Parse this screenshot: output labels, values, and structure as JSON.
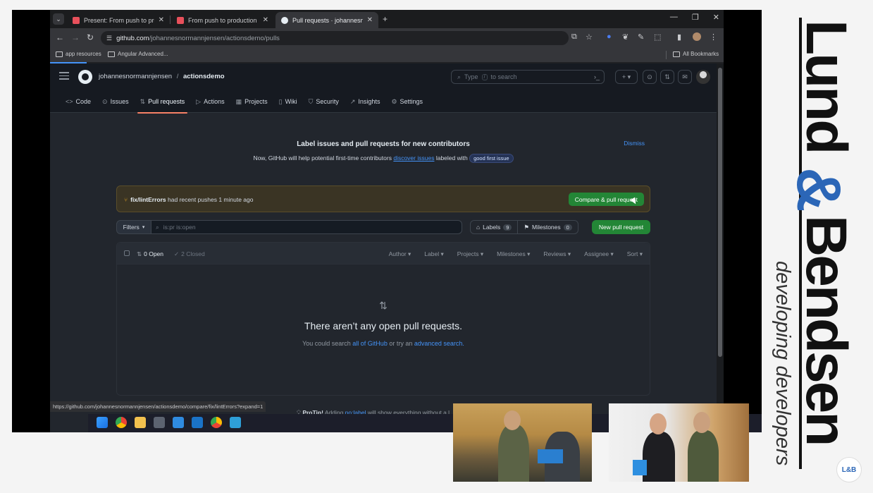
{
  "browser": {
    "tabs": [
      {
        "title": "Present: From push to producti",
        "favicon_color": "#e8505b",
        "active": false
      },
      {
        "title": "From push to production",
        "favicon_color": "#e8505b",
        "active": false
      },
      {
        "title": "Pull requests · johannesnormar",
        "favicon_color": "#e6edf3",
        "active": true
      }
    ],
    "new_tab": "+",
    "url_host": "github.com",
    "url_path": "/johannesnormannjensen/actionsdemo/pulls",
    "bookmarks": [
      "app resources",
      "Angular Advanced..."
    ],
    "all_bookmarks": "All Bookmarks",
    "status_url": "https://github.com/johannesnormannjensen/actionsdemo/compare/fix/lintErrors?expand=1"
  },
  "github": {
    "owner": "johannesnormannjensen",
    "separator": "/",
    "repo": "actionsdemo",
    "search_placeholder_pre": "Type",
    "search_slash": "/",
    "search_placeholder_post": "to search",
    "repo_nav": [
      {
        "label": "Code",
        "icon": "<>"
      },
      {
        "label": "Issues",
        "icon": "⊙"
      },
      {
        "label": "Pull requests",
        "icon": "⇅"
      },
      {
        "label": "Actions",
        "icon": "▷"
      },
      {
        "label": "Projects",
        "icon": "▦"
      },
      {
        "label": "Wiki",
        "icon": "▯"
      },
      {
        "label": "Security",
        "icon": "⛉"
      },
      {
        "label": "Insights",
        "icon": "↗"
      },
      {
        "label": "Settings",
        "icon": "⚙"
      }
    ],
    "banner": {
      "title": "Label issues and pull requests for new contributors",
      "text_pre": "Now, GitHub will help potential first-time contributors",
      "link": "discover issues",
      "text_mid": "labeled with",
      "label": "good first issue",
      "dismiss": "Dismiss"
    },
    "push": {
      "branch": "fix/lintErrors",
      "text": "had recent pushes 1 minute ago",
      "button": "Compare & pull request"
    },
    "filters": {
      "button": "Filters",
      "query": "is:pr is:open",
      "labels": "Labels",
      "labels_count": "9",
      "milestones": "Milestones",
      "milestones_count": "0",
      "new_pr": "New pull request"
    },
    "list": {
      "open": "0 Open",
      "closed": "2 Closed",
      "sorts": [
        "Author",
        "Label",
        "Projects",
        "Milestones",
        "Reviews",
        "Assignee",
        "Sort"
      ],
      "empty_title": "There aren’t any open pull requests.",
      "empty_pre": "You could search",
      "empty_link1": "all of GitHub",
      "empty_mid": "or try an",
      "empty_link2": "advanced search."
    },
    "protip": {
      "label": "ProTip!",
      "pre": "Adding",
      "link": "no:label",
      "post": "will show everything without a l"
    }
  },
  "branding": {
    "word1": "Lund",
    "amp": "&",
    "word2": "Bendsen",
    "tagline": "developing developers",
    "badge": "L&B",
    "blue": "#2b66b7"
  }
}
